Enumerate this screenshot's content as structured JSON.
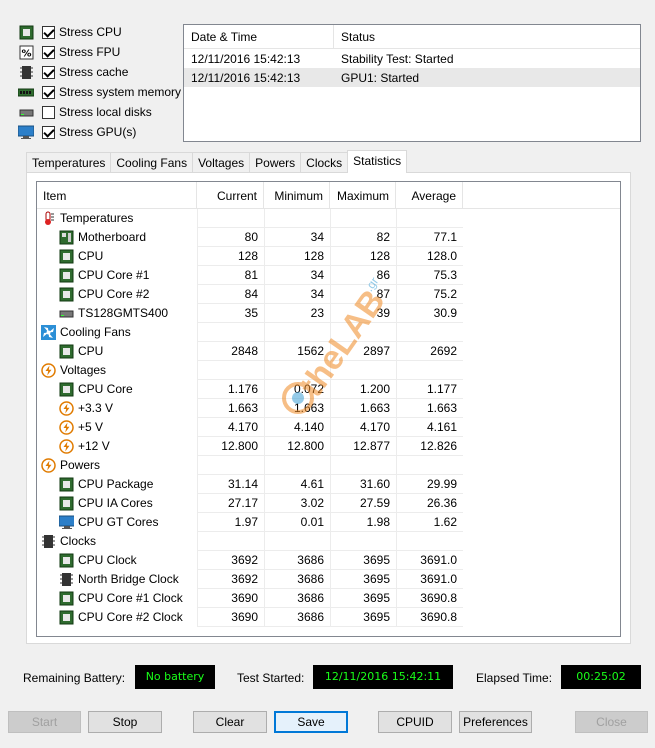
{
  "stress_options": [
    {
      "label": "Stress CPU",
      "checked": true,
      "icon": "cpu-chip-icon"
    },
    {
      "label": "Stress FPU",
      "checked": true,
      "icon": "fpu-percent-icon"
    },
    {
      "label": "Stress cache",
      "checked": true,
      "icon": "cache-icon"
    },
    {
      "label": "Stress system memory",
      "checked": true,
      "icon": "memory-module-icon"
    },
    {
      "label": "Stress local disks",
      "checked": false,
      "icon": "hard-disk-icon"
    },
    {
      "label": "Stress GPU(s)",
      "checked": true,
      "icon": "monitor-gpu-icon"
    }
  ],
  "log": {
    "headers": [
      "Date & Time",
      "Status"
    ],
    "rows": [
      {
        "datetime": "12/11/2016 15:42:13",
        "status": "Stability Test: Started"
      },
      {
        "datetime": "12/11/2016 15:42:13",
        "status": "GPU1: Started"
      }
    ]
  },
  "tabs": [
    "Temperatures",
    "Cooling Fans",
    "Voltages",
    "Powers",
    "Clocks",
    "Statistics"
  ],
  "active_tab": "Statistics",
  "table": {
    "headers": {
      "item": "Item",
      "current": "Current",
      "minimum": "Minimum",
      "maximum": "Maximum",
      "average": "Average"
    },
    "groups": [
      {
        "name": "Temperatures",
        "icon": "thermometer-icon",
        "rows": [
          {
            "name": "Motherboard",
            "icon": "motherboard-icon",
            "current": "80",
            "minimum": "34",
            "maximum": "82",
            "average": "77.1"
          },
          {
            "name": "CPU",
            "icon": "cpu-chip-icon",
            "current": "128",
            "minimum": "128",
            "maximum": "128",
            "average": "128.0"
          },
          {
            "name": "CPU Core #1",
            "icon": "cpu-chip-icon",
            "current": "81",
            "minimum": "34",
            "maximum": "86",
            "average": "75.3"
          },
          {
            "name": "CPU Core #2",
            "icon": "cpu-chip-icon",
            "current": "84",
            "minimum": "34",
            "maximum": "87",
            "average": "75.2"
          },
          {
            "name": "TS128GMTS400",
            "icon": "hard-disk-icon",
            "current": "35",
            "minimum": "23",
            "maximum": "39",
            "average": "30.9"
          }
        ]
      },
      {
        "name": "Cooling Fans",
        "icon": "fan-icon",
        "rows": [
          {
            "name": "CPU",
            "icon": "cpu-chip-icon",
            "current": "2848",
            "minimum": "1562",
            "maximum": "2897",
            "average": "2692"
          }
        ]
      },
      {
        "name": "Voltages",
        "icon": "lightning-icon",
        "rows": [
          {
            "name": "CPU Core",
            "icon": "cpu-chip-icon",
            "current": "1.176",
            "minimum": "0.072",
            "maximum": "1.200",
            "average": "1.177"
          },
          {
            "name": "+3.3 V",
            "icon": "lightning-icon",
            "current": "1.663",
            "minimum": "1.663",
            "maximum": "1.663",
            "average": "1.663"
          },
          {
            "name": "+5 V",
            "icon": "lightning-icon",
            "current": "4.170",
            "minimum": "4.140",
            "maximum": "4.170",
            "average": "4.161"
          },
          {
            "name": "+12 V",
            "icon": "lightning-icon",
            "current": "12.800",
            "minimum": "12.800",
            "maximum": "12.877",
            "average": "12.826"
          }
        ]
      },
      {
        "name": "Powers",
        "icon": "lightning-icon",
        "rows": [
          {
            "name": "CPU Package",
            "icon": "cpu-chip-icon",
            "current": "31.14",
            "minimum": "4.61",
            "maximum": "31.60",
            "average": "29.99"
          },
          {
            "name": "CPU IA Cores",
            "icon": "cpu-chip-icon",
            "current": "27.17",
            "minimum": "3.02",
            "maximum": "27.59",
            "average": "26.36"
          },
          {
            "name": "CPU GT Cores",
            "icon": "monitor-gpu-icon",
            "current": "1.97",
            "minimum": "0.01",
            "maximum": "1.98",
            "average": "1.62"
          }
        ]
      },
      {
        "name": "Clocks",
        "icon": "clock-chip-icon",
        "rows": [
          {
            "name": "CPU Clock",
            "icon": "cpu-chip-icon",
            "current": "3692",
            "minimum": "3686",
            "maximum": "3695",
            "average": "3691.0"
          },
          {
            "name": "North Bridge Clock",
            "icon": "clock-chip-icon",
            "current": "3692",
            "minimum": "3686",
            "maximum": "3695",
            "average": "3691.0"
          },
          {
            "name": "CPU Core #1 Clock",
            "icon": "cpu-chip-icon",
            "current": "3690",
            "minimum": "3686",
            "maximum": "3695",
            "average": "3690.8"
          },
          {
            "name": "CPU Core #2 Clock",
            "icon": "cpu-chip-icon",
            "current": "3690",
            "minimum": "3686",
            "maximum": "3695",
            "average": "3690.8"
          }
        ]
      }
    ]
  },
  "watermark": {
    "text": "theLAB",
    "suffix": ".gr"
  },
  "status": {
    "battery_label": "Remaining Battery:",
    "battery_value": "No battery",
    "started_label": "Test Started:",
    "started_value": "12/11/2016 15:42:11",
    "elapsed_label": "Elapsed Time:",
    "elapsed_value": "00:25:02"
  },
  "buttons": {
    "start": "Start",
    "stop": "Stop",
    "clear": "Clear",
    "save": "Save",
    "cpuid": "CPUID",
    "preferences": "Preferences",
    "close": "Close"
  },
  "colors": {
    "led_green": "#19ff19",
    "focus_blue": "#0078d7"
  }
}
